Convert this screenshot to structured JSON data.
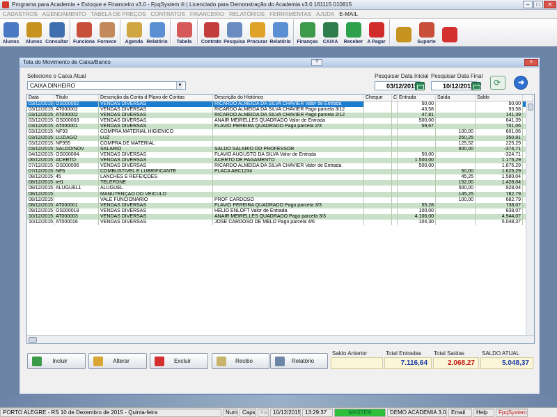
{
  "window_title": "Programa para Academia + Estoque e Financeiro v3.0 - FpqSystem ® | Licenciado para Demonstração do Academia v3.0 161115 010815",
  "menu": [
    "CADASTROS",
    "AGENDAMENTO",
    "TABELA DE PREÇOS",
    "CONTRATOS",
    "FINANCEIRO",
    "RELATÓRIOS",
    "FERRAMENTAS",
    "AJUDA",
    "E-MAIL"
  ],
  "toolbar": [
    {
      "label": "Alunos",
      "icon": "students-icon",
      "color": "#4a79c4"
    },
    {
      "label": "Alunos",
      "icon": "coins-icon",
      "color": "#c79320"
    },
    {
      "label": "Consultar",
      "icon": "id-card-icon",
      "color": "#3f6fae"
    },
    {
      "label": "Funciona",
      "icon": "employee-icon",
      "color": "#c8503a"
    },
    {
      "label": "Fornece",
      "icon": "supplier-icon",
      "color": "#c28a5a"
    },
    {
      "label": "Agenda",
      "icon": "agenda-icon",
      "color": "#d0a642"
    },
    {
      "label": "Relatório",
      "icon": "report-icon",
      "color": "#5b8fd4"
    },
    {
      "label": "Tabela",
      "icon": "table-icon",
      "color": "#d65a5a"
    },
    {
      "label": "Contrato",
      "icon": "contract-icon",
      "color": "#c43d3d"
    },
    {
      "label": "Pesquisa",
      "icon": "search-icon",
      "color": "#6a8cc0"
    },
    {
      "label": "Procurar",
      "icon": "folder-icon",
      "color": "#e0a32a"
    },
    {
      "label": "Relatório",
      "icon": "report-icon",
      "color": "#5b8fd4"
    },
    {
      "label": "Finanças",
      "icon": "finance-icon",
      "color": "#3c9a4a"
    },
    {
      "label": "CAIXA",
      "icon": "cash-register-icon",
      "color": "#2e7d4a"
    },
    {
      "label": "Receber",
      "icon": "receive-money-icon",
      "color": "#2ca04a"
    },
    {
      "label": "A Pagar",
      "icon": "pay-money-icon",
      "color": "#d12c2c"
    },
    {
      "label": "",
      "icon": "coins-icon",
      "color": "#c79320"
    },
    {
      "label": "Suporte",
      "icon": "support-icon",
      "color": "#c8503a"
    },
    {
      "label": "",
      "icon": "exit-icon",
      "color": "#d43030"
    }
  ],
  "dialog": {
    "title": "Tela do Movimento de Caixa/Banco",
    "select_label": "Selecione o Caixa Atual",
    "select_value": "CAIXA DINHEIRO",
    "start_label": "Pesquisar Data Inicial",
    "start_value": "03/12/2015",
    "end_label": "Pesquisar Data Final",
    "end_value": "10/12/2015"
  },
  "table": {
    "headers": [
      "Data",
      "Título",
      "Descrição da Conta d Plano de Contas",
      "Descrição do Histórico",
      "Cheque",
      "C",
      "Entrada",
      "Saída",
      "Saldo"
    ],
    "rows": [
      [
        "03/12/2015",
        "OS000002",
        "VENDAS DIVERSAS",
        "RICARDO ALMEIDA DA SILVA CHAVIER Valor de Entrada",
        "",
        "",
        "50,00",
        "",
        "50,00"
      ],
      [
        "03/12/2015",
        "AT000002",
        "VENDAS DIVERSAS",
        "RICARDO ALMEIDA DA SILVA CHAVIER Pago parcela 3/12",
        "",
        "",
        "43,58",
        "",
        "93,58"
      ],
      [
        "03/12/2015",
        "AT000002",
        "VENDAS DIVERSAS",
        "RICARDO ALMEIDA DA SILVA CHAVIER Pago parcela 2/12",
        "",
        "",
        "47,81",
        "",
        "141,39"
      ],
      [
        "03/12/2015",
        "OS000003",
        "VENDAS DIVERSAS",
        "ANAIR MEIRELLES QUADRADO Valor de Entrada",
        "",
        "",
        "500,00",
        "",
        "641,39"
      ],
      [
        "03/12/2015",
        "AT000001",
        "VENDAS DIVERSAS",
        "FLAVIO PEREIRA QUADRADO Pago parcela 2/3",
        "",
        "",
        "59,67",
        "",
        "701,06"
      ],
      [
        "03/12/2015",
        "NF93",
        "COMPRA MATERIAL HIGIENICO",
        "",
        "",
        "",
        "",
        "100,00",
        "601,06"
      ],
      [
        "03/12/2015",
        "LUZ/AGO",
        "LUZ",
        "",
        "",
        "",
        "",
        "250,25",
        "350,81"
      ],
      [
        "03/12/2015",
        "NF955",
        "COMPRA DE MATERIAL",
        "",
        "",
        "",
        "",
        "125,52",
        "225,29"
      ],
      [
        "03/12/2015",
        "SALDO/NOV",
        "SALARIO",
        "SALDO SALARIO DO PROFESSOR",
        "",
        "",
        "",
        "600,00",
        "-374,71"
      ],
      [
        "04/12/2015",
        "OS000004",
        "VENDAS DIVERSAS",
        "FLAVIO AUGUSTO DA SILVA Valor de Entrada",
        "",
        "",
        "50,00",
        "",
        "-324,71"
      ],
      [
        "06/12/2015",
        "ACERTO",
        "VENDAS DIVERSAS",
        "ACERTO DE PAGAMENTO",
        "",
        "",
        "1.500,00",
        "",
        "1.175,29"
      ],
      [
        "07/12/2015",
        "OS000006",
        "VENDAS DIVERSAS",
        "RICARDO ALMEIDA DA SILVA CHAVIER Valor de Entrada",
        "",
        "",
        "500,00",
        "",
        "1.675,29"
      ],
      [
        "07/12/2015",
        "NF6",
        "COMBUSTIVEL E LUBRIFICANTE",
        "PLACA ABC1234",
        "",
        "",
        "",
        "50,00",
        "1.625,29"
      ],
      [
        "08/12/2015",
        "45",
        "LANCHES E REFEIÇÕES",
        "",
        "",
        "",
        "",
        "45,25",
        "1.580,04"
      ],
      [
        "08/12/2015",
        "tel1",
        "TELEFONE",
        "",
        "",
        "",
        "",
        "152,00",
        "1.428,04"
      ],
      [
        "08/12/2015",
        "ALUGUEL1",
        "ALUGUEL",
        "",
        "",
        "",
        "",
        "500,00",
        "928,04"
      ],
      [
        "08/12/2015",
        "",
        "MANUTENÇÃO DO VEÍCULO",
        "",
        "",
        "",
        "",
        "145,25",
        "782,79"
      ],
      [
        "08/12/2015",
        "",
        "VALE FUNCIONARIO",
        "PROF CARDOSO",
        "",
        "",
        "",
        "100,00",
        "682,79"
      ],
      [
        "08/12/2015",
        "AT000001",
        "VENDAS DIVERSAS",
        "FLAVIO PEREIRA QUADRADO Pago parcela 3/3",
        "",
        "",
        "55,28",
        "",
        "738,07"
      ],
      [
        "09/12/2015",
        "OS000018",
        "VENDAS DIVERSAS",
        "HELIO ENLOFT Valor de Entrada",
        "",
        "",
        "100,00",
        "",
        "838,07"
      ],
      [
        "10/12/2015",
        "AT000003",
        "VENDAS DIVERSAS",
        "ANAIR MEIRELLES QUADRADO Pago parcela 3/3",
        "",
        "",
        "4.106,00",
        "",
        "4.944,07"
      ],
      [
        "10/12/2015",
        "AT000016",
        "VENDAS DIVERSAS",
        "JOSE CARDOSO DE MELO Pago parcela 4/6",
        "",
        "",
        "104,30",
        "",
        "5.048,37"
      ]
    ]
  },
  "buttons": [
    {
      "label": "Incluir",
      "icon": "add-icon",
      "color": "#3a9a4a"
    },
    {
      "label": "Alterar",
      "icon": "edit-icon",
      "color": "#d9a634"
    },
    {
      "label": "Excluir",
      "icon": "delete-icon",
      "color": "#d43030"
    },
    {
      "label": "Recibo",
      "icon": "receipt-icon",
      "color": "#c8b46a"
    },
    {
      "label": "Relatório",
      "icon": "printer-icon",
      "color": "#6d86a8"
    }
  ],
  "totals": {
    "saldo_anterior_label": "Saldo Anterior",
    "saldo_anterior_value": "",
    "entradas_label": "Total Entradas",
    "entradas_value": "7.116,64",
    "saidas_label": "Total Saídas",
    "saidas_value": "2.068,27",
    "saldo_label": "SALDO ATUAL",
    "saldo_value": "5.048,37",
    "entradas_color": "#1a3aa8",
    "saidas_color": "#c41818",
    "saldo_color": "#1a3aa8"
  },
  "status": [
    "PORTO ALEGRE - RS 10 de Dezembro de 2015 - Quinta-feira",
    "Num",
    "Caps",
    "Ins",
    "10/12/2015",
    "13:29:37",
    "MASTER",
    "DEMO ACADEMIA 3.0",
    "Email",
    "Help",
    "FpqSystem"
  ]
}
